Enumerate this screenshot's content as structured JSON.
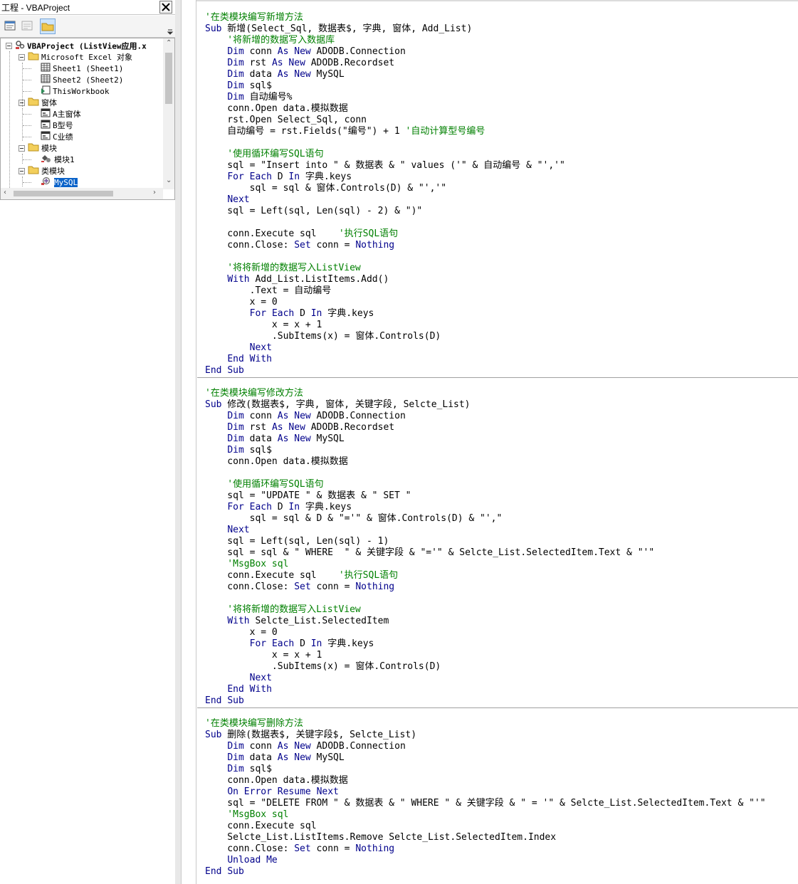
{
  "project": {
    "window_title": "工程 - VBAProject",
    "tree": [
      {
        "label": "VBAProject (ListView应用.x",
        "icon": "vba-project-icon",
        "bold": true
      },
      {
        "label": "Microsoft Excel 对象",
        "icon": "folder-icon"
      },
      {
        "label": "Sheet1 (Sheet1)",
        "icon": "worksheet-icon"
      },
      {
        "label": "Sheet2 (Sheet2)",
        "icon": "worksheet-icon"
      },
      {
        "label": "ThisWorkbook",
        "icon": "workbook-icon"
      },
      {
        "label": "窗体",
        "icon": "folder-icon"
      },
      {
        "label": "A主窗体",
        "icon": "userform-icon"
      },
      {
        "label": "B型号",
        "icon": "userform-icon"
      },
      {
        "label": "C业绩",
        "icon": "userform-icon"
      },
      {
        "label": "模块",
        "icon": "folder-icon"
      },
      {
        "label": "模块1",
        "icon": "module-icon"
      },
      {
        "label": "类模块",
        "icon": "folder-icon"
      },
      {
        "label": "MySQL",
        "icon": "class-module-icon",
        "selected": true
      }
    ]
  },
  "code": {
    "keyword_color": "#00008B",
    "comment_color": "#008000",
    "lines": [
      {
        "t": "'在类模块编写新增方法",
        "k": "c"
      },
      {
        "t": "Sub 新增(Select_Sql, 数据表$, 字典, 窗体, Add_List)"
      },
      {
        "t": "    '将新增的数据写入数据库",
        "k": "c"
      },
      {
        "t": "    Dim conn As New ADODB.Connection"
      },
      {
        "t": "    Dim rst As New ADODB.Recordset"
      },
      {
        "t": "    Dim data As New MySQL"
      },
      {
        "t": "    Dim sql$"
      },
      {
        "t": "    Dim 自动编号%"
      },
      {
        "t": "    conn.Open data.模拟数据"
      },
      {
        "t": "    rst.Open Select_Sql, conn"
      },
      {
        "t": "    自动编号 = rst.Fields(\"编号\") + 1 ",
        "c": "'自动计算型号编号"
      },
      {
        "t": ""
      },
      {
        "t": "    '使用循环编写SQL语句",
        "k": "c"
      },
      {
        "t": "    sql = \"Insert into \" & 数据表 & \" values ('\" & 自动编号 & \"','\""
      },
      {
        "t": "    For Each D In 字典.keys"
      },
      {
        "t": "        sql = sql & 窗体.Controls(D) & \"','\""
      },
      {
        "t": "    Next"
      },
      {
        "t": "    sql = Left(sql, Len(sql) - 2) & \")\""
      },
      {
        "t": ""
      },
      {
        "t": "    conn.Execute sql    ",
        "c": "'执行SQL语句"
      },
      {
        "t": "    conn.Close: Set conn = Nothing"
      },
      {
        "t": ""
      },
      {
        "t": "    '将将新增的数据写入ListView",
        "k": "c"
      },
      {
        "t": "    With Add_List.ListItems.Add()"
      },
      {
        "t": "        .Text = 自动编号"
      },
      {
        "t": "        x = 0"
      },
      {
        "t": "        For Each D In 字典.keys"
      },
      {
        "t": "            x = x + 1"
      },
      {
        "t": "            .SubItems(x) = 窗体.Controls(D)"
      },
      {
        "t": "        Next"
      },
      {
        "t": "    End With"
      },
      {
        "t": "End Sub"
      },
      {
        "t": "",
        "k": "sep"
      },
      {
        "t": "'在类模块编写修改方法",
        "k": "c"
      },
      {
        "t": "Sub 修改(数据表$, 字典, 窗体, 关键字段, Selcte_List)"
      },
      {
        "t": "    Dim conn As New ADODB.Connection"
      },
      {
        "t": "    Dim rst As New ADODB.Recordset"
      },
      {
        "t": "    Dim data As New MySQL"
      },
      {
        "t": "    Dim sql$"
      },
      {
        "t": "    conn.Open data.模拟数据"
      },
      {
        "t": ""
      },
      {
        "t": "    '使用循环编写SQL语句",
        "k": "c"
      },
      {
        "t": "    sql = \"UPDATE \" & 数据表 & \" SET \""
      },
      {
        "t": "    For Each D In 字典.keys"
      },
      {
        "t": "        sql = sql & D & \"='\" & 窗体.Controls(D) & \"',\""
      },
      {
        "t": "    Next"
      },
      {
        "t": "    sql = Left(sql, Len(sql) - 1)"
      },
      {
        "t": "    sql = sql & \" WHERE  \" & 关键字段 & \"='\" & Selcte_List.SelectedItem.Text & \"'\""
      },
      {
        "t": "    'MsgBox sql",
        "k": "c"
      },
      {
        "t": "    conn.Execute sql    ",
        "c": "'执行SQL语句"
      },
      {
        "t": "    conn.Close: Set conn = Nothing"
      },
      {
        "t": ""
      },
      {
        "t": "    '将将新增的数据写入ListView",
        "k": "c"
      },
      {
        "t": "    With Selcte_List.SelectedItem"
      },
      {
        "t": "        x = 0"
      },
      {
        "t": "        For Each D In 字典.keys"
      },
      {
        "t": "            x = x + 1"
      },
      {
        "t": "            .SubItems(x) = 窗体.Controls(D)"
      },
      {
        "t": "        Next"
      },
      {
        "t": "    End With"
      },
      {
        "t": "End Sub"
      },
      {
        "t": "",
        "k": "sep"
      },
      {
        "t": "'在类模块编写删除方法",
        "k": "c"
      },
      {
        "t": "Sub 删除(数据表$, 关键字段$, Selcte_List)"
      },
      {
        "t": "    Dim conn As New ADODB.Connection"
      },
      {
        "t": "    Dim data As New MySQL"
      },
      {
        "t": "    Dim sql$"
      },
      {
        "t": "    conn.Open data.模拟数据"
      },
      {
        "t": "    On Error Resume Next"
      },
      {
        "t": "    sql = \"DELETE FROM \" & 数据表 & \" WHERE \" & 关键字段 & \" = '\" & Selcte_List.SelectedItem.Text & \"'\""
      },
      {
        "t": "    'MsgBox sql",
        "k": "c"
      },
      {
        "t": "    conn.Execute sql"
      },
      {
        "t": "    Selcte_List.ListItems.Remove Selcte_List.SelectedItem.Index"
      },
      {
        "t": "    conn.Close: Set conn = Nothing"
      },
      {
        "t": "    Unload Me"
      },
      {
        "t": "End Sub"
      }
    ]
  }
}
